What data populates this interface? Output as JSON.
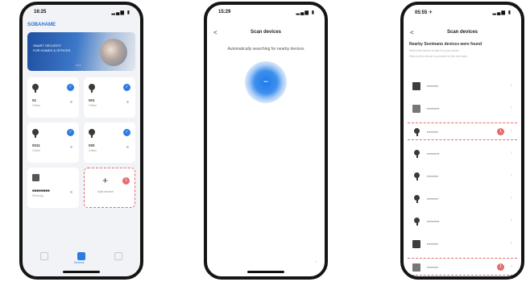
{
  "phone1": {
    "status": {
      "time": "16:25",
      "signal": "▂▄▆ ▮"
    },
    "brand": "SOBAHAME",
    "banner": {
      "line1": "SMART SECURITY",
      "line2": "FOR HOMES & OFFICES",
      "dots": "•••"
    },
    "cards": [
      {
        "name": "01",
        "sub": "Online",
        "icon": "camera-icon",
        "control": "≡"
      },
      {
        "name": "001",
        "sub": "Online",
        "icon": "camera-icon",
        "control": "≡"
      },
      {
        "name": "0011",
        "sub": "Online",
        "icon": "camera-icon",
        "control": "≡"
      },
      {
        "name": "000",
        "sub": "Online",
        "icon": "camera-icon",
        "control": "≡"
      },
      {
        "name": "■■■■■■■■",
        "sub": "Sleeping",
        "icon": "hub-icon",
        "control": "≡"
      }
    ],
    "add_card": {
      "plus": "+",
      "label": "Add device",
      "badge": "1"
    },
    "tabs": [
      {
        "label": ""
      },
      {
        "label": "Devices"
      },
      {
        "label": ""
      }
    ]
  },
  "phone2": {
    "status": {
      "time": "15:29",
      "signal": "▂▄▆ ▮"
    },
    "back": "<",
    "title": "Scan devices",
    "hint": "Automatically searching for nearby devices",
    "scan_mark": "•••",
    "corner": "⌟"
  },
  "phone3": {
    "status": {
      "time": "05:55 ✈",
      "signal": "▂▄▆ ▮"
    },
    "back": "<",
    "title": "Scan devices",
    "found": "Nearby Sovimano devices were found",
    "notes": [
      "Select the device to add it to your home",
      "Click on the device to proceed to the next step"
    ],
    "devices": [
      {
        "label": "▪▪▪▪▪▪▪▪▪▪",
        "icon": "box",
        "badge": "",
        "highlight": false
      },
      {
        "label": "▪▪▪▪▪▪▪▪▪▪▪",
        "icon": "box2",
        "badge": "",
        "highlight": false
      },
      {
        "label": "▪▪▪▪▪▪▪▪▪▪",
        "icon": "cam2",
        "badge": "1",
        "highlight": true
      },
      {
        "label": "▪▪▪▪▪▪▪▪▪▪▪",
        "icon": "cam2",
        "badge": "",
        "highlight": false
      },
      {
        "label": "▪▪▪▪▪▪▪▪▪▪",
        "icon": "cam2",
        "badge": "",
        "highlight": false
      },
      {
        "label": "▪▪▪▪▪▪▪▪▪▪",
        "icon": "cam2",
        "badge": "",
        "highlight": false
      },
      {
        "label": "▪▪▪▪▪▪▪▪▪▪▪",
        "icon": "cam2",
        "badge": "",
        "highlight": false
      },
      {
        "label": "▪▪▪▪▪▪▪▪▪▪",
        "icon": "box",
        "badge": "",
        "highlight": false
      },
      {
        "label": "▪▪▪▪▪▪▪▪▪▪",
        "icon": "box2",
        "badge": "1",
        "highlight": true
      }
    ],
    "chevron": "›"
  },
  "colors": {
    "accent": "#2c7be5",
    "badge": "#e86a6a",
    "frame": "#151515"
  }
}
